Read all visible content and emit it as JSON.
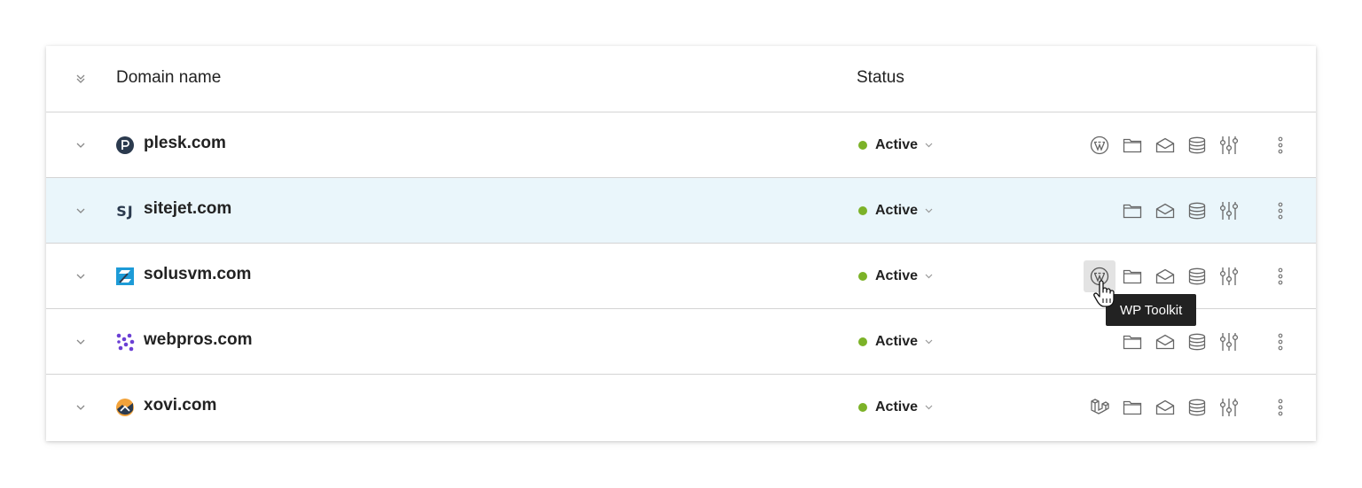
{
  "header": {
    "domain_col": "Domain name",
    "status_col": "Status"
  },
  "rows": [
    {
      "domain": "plesk.com",
      "favicon": "plesk-logo",
      "status": "Active"
    },
    {
      "domain": "sitejet.com",
      "favicon": "sitejet-logo",
      "favicon_text": "SJ",
      "status": "Active"
    },
    {
      "domain": "solusvm.com",
      "favicon": "solusvm-logo",
      "status": "Active"
    },
    {
      "domain": "webpros.com",
      "favicon": "webpros-logo",
      "status": "Active"
    },
    {
      "domain": "xovi.com",
      "favicon": "xovi-logo",
      "status": "Active"
    }
  ],
  "tooltip": "WP Toolkit",
  "colors": {
    "status_active": "#7cb228",
    "row_hover": "#eaf6fb",
    "tooltip_bg": "#222222"
  }
}
